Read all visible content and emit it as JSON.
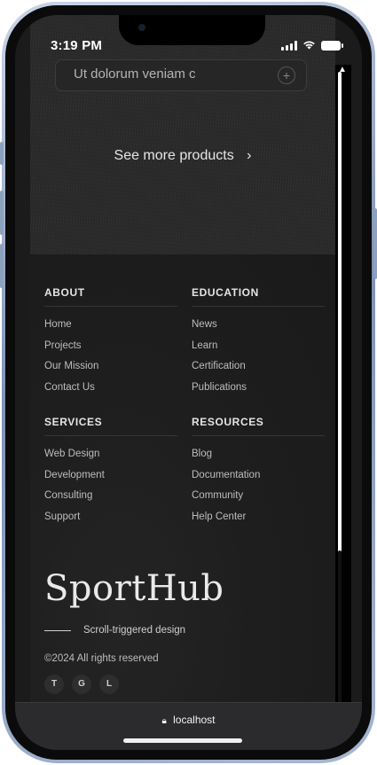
{
  "status_bar": {
    "time": "3:19 PM"
  },
  "products": {
    "card_text": "Ut dolorum veniam c",
    "card_button": "+",
    "see_more": "See more products",
    "see_more_chevron": "›"
  },
  "footer": {
    "columns": [
      {
        "heading": "ABOUT",
        "links": [
          "Home",
          "Projects",
          "Our Mission",
          "Contact Us"
        ]
      },
      {
        "heading": "EDUCATION",
        "links": [
          "News",
          "Learn",
          "Certification",
          "Publications"
        ]
      },
      {
        "heading": "SERVICES",
        "links": [
          "Web Design",
          "Development",
          "Consulting",
          "Support"
        ]
      },
      {
        "heading": "RESOURCES",
        "links": [
          "Blog",
          "Documentation",
          "Community",
          "Help Center"
        ]
      }
    ],
    "brand": "SportHub",
    "tagline": "Scroll-triggered design",
    "copyright": "©2024 All rights reserved",
    "socials": [
      "T",
      "G",
      "L"
    ]
  },
  "browser": {
    "url": "localhost"
  },
  "icons": {
    "lock": "lock-icon",
    "signal": "signal-icon",
    "wifi": "wifi-icon",
    "battery": "battery-icon"
  }
}
